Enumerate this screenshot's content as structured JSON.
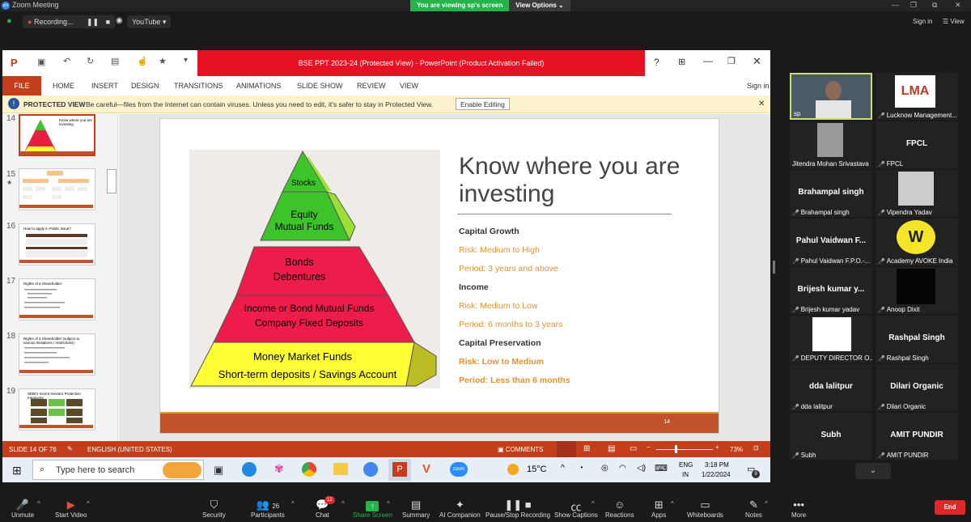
{
  "zoom": {
    "app_title": "Zoom Meeting",
    "viewing_banner": "You are viewing sp's screen",
    "view_options": "View Options",
    "recording": "Recording...",
    "youtube": "YouTube",
    "sign_in": "Sign in",
    "view": "View"
  },
  "ppt": {
    "title": "BSE PPT 2023-24 (Protected View) - PowerPoint (Product Activation Failed)",
    "menu": [
      "FILE",
      "HOME",
      "INSERT",
      "DESIGN",
      "TRANSITIONS",
      "ANIMATIONS",
      "SLIDE SHOW",
      "REVIEW",
      "VIEW"
    ],
    "sign_in": "Sign in",
    "protected_label": "PROTECTED VIEW",
    "protected_msg": "Be careful—files from the Internet can contain viruses. Unless you need to edit, it's safer to stay in Protected View.",
    "enable_editing": "Enable Editing",
    "thumbnails": [
      {
        "num": "14",
        "text": "Know where you are investing"
      },
      {
        "num": "15",
        "text": ""
      },
      {
        "num": "16",
        "text": "How to apply in Public Issue?"
      },
      {
        "num": "17",
        "text": "Rights of a Shareholder"
      },
      {
        "num": "18",
        "text": "Rights of a Shareholder (subject to various limitations / restrictions)"
      },
      {
        "num": "19",
        "text": "SEBI's recent Investor Protection measures"
      }
    ],
    "slide": {
      "title": "Know where you are investing",
      "pyramid": [
        "Stocks",
        "Equity Mutual Funds",
        "Bonds Debentures",
        "Income or Bond Mutual Funds Company Fixed Deposits",
        "Money Market Funds Short-term deposits / Savings Account"
      ],
      "sections": [
        {
          "heading": "Capital Growth",
          "risk": "Risk: Medium to High",
          "period": "Period: 3 years and above"
        },
        {
          "heading": "Income",
          "risk": "Risk: Medium to Low",
          "period": "Period: 6 months to 3 years"
        },
        {
          "heading": "Capital Preservation",
          "risk": "Risk: Low  to Medium",
          "period": "Period: Less than 6 months"
        }
      ],
      "page_num": "14"
    },
    "status": {
      "slide": "SLIDE 14 OF 76",
      "lang": "ENGLISH (UNITED STATES)",
      "comments": "COMMENTS",
      "zoom": "73%"
    },
    "taskbar": {
      "search": "Type here to search",
      "weather": "15°C",
      "lang1": "ENG",
      "lang2": "IN",
      "time": "3:18 PM",
      "date": "1/22/2024",
      "notif": "9"
    }
  },
  "participants": [
    {
      "name": "sp",
      "big": ""
    },
    {
      "name": "Lucknow Management...",
      "big": ""
    },
    {
      "name": "Jitendra Mohan Srivastava",
      "big": ""
    },
    {
      "name": "FPCL",
      "big": "FPCL"
    },
    {
      "name": "Brahampal singh",
      "big": "Brahampal singh"
    },
    {
      "name": "Vipendra Yadav",
      "big": ""
    },
    {
      "name": "Pahul Vaidwan F.P.O.-...",
      "big": "Pahul Vaidwan F..."
    },
    {
      "name": "Academy AVOKE India",
      "big": ""
    },
    {
      "name": "Brijesh kumar yadav",
      "big": "Brijesh kumar y..."
    },
    {
      "name": "Anoop Dixit",
      "big": ""
    },
    {
      "name": "DEPUTY DIRECTOR O...",
      "big": ""
    },
    {
      "name": "Rashpal Singh",
      "big": "Rashpal Singh"
    },
    {
      "name": "dda lalitpur",
      "big": "dda lalitpur"
    },
    {
      "name": "Dilari Organic",
      "big": "Dilari Organic"
    },
    {
      "name": "Subh",
      "big": "Subh"
    },
    {
      "name": "AMIT PUNDIR",
      "big": "AMIT PUNDIR"
    }
  ],
  "toolbar": [
    {
      "label": "Unmute",
      "icon": "mic-off-icon"
    },
    {
      "label": "Start Video",
      "icon": "video-off-icon"
    },
    {
      "label": "Security",
      "icon": "shield-icon"
    },
    {
      "label": "Participants",
      "icon": "participants-icon",
      "badge": "26"
    },
    {
      "label": "Chat",
      "icon": "chat-icon",
      "badge": "12"
    },
    {
      "label": "Share Screen",
      "icon": "share-icon"
    },
    {
      "label": "Summary",
      "icon": "summary-icon"
    },
    {
      "label": "AI Companion",
      "icon": "sparkle-icon"
    },
    {
      "label": "Pause/Stop Recording",
      "icon": "pause-icon"
    },
    {
      "label": "Show Captions",
      "icon": "cc-icon"
    },
    {
      "label": "Reactions",
      "icon": "reaction-icon"
    },
    {
      "label": "Apps",
      "icon": "apps-icon"
    },
    {
      "label": "Whiteboards",
      "icon": "whiteboard-icon"
    },
    {
      "label": "Notes",
      "icon": "notes-icon"
    },
    {
      "label": "More",
      "icon": "more-icon"
    }
  ],
  "end_label": "End",
  "colors": {
    "ppt_red": "#c43e1c",
    "title_red": "#e81123",
    "zoom_green": "#25b34b",
    "orange_text": "#e8912c"
  }
}
